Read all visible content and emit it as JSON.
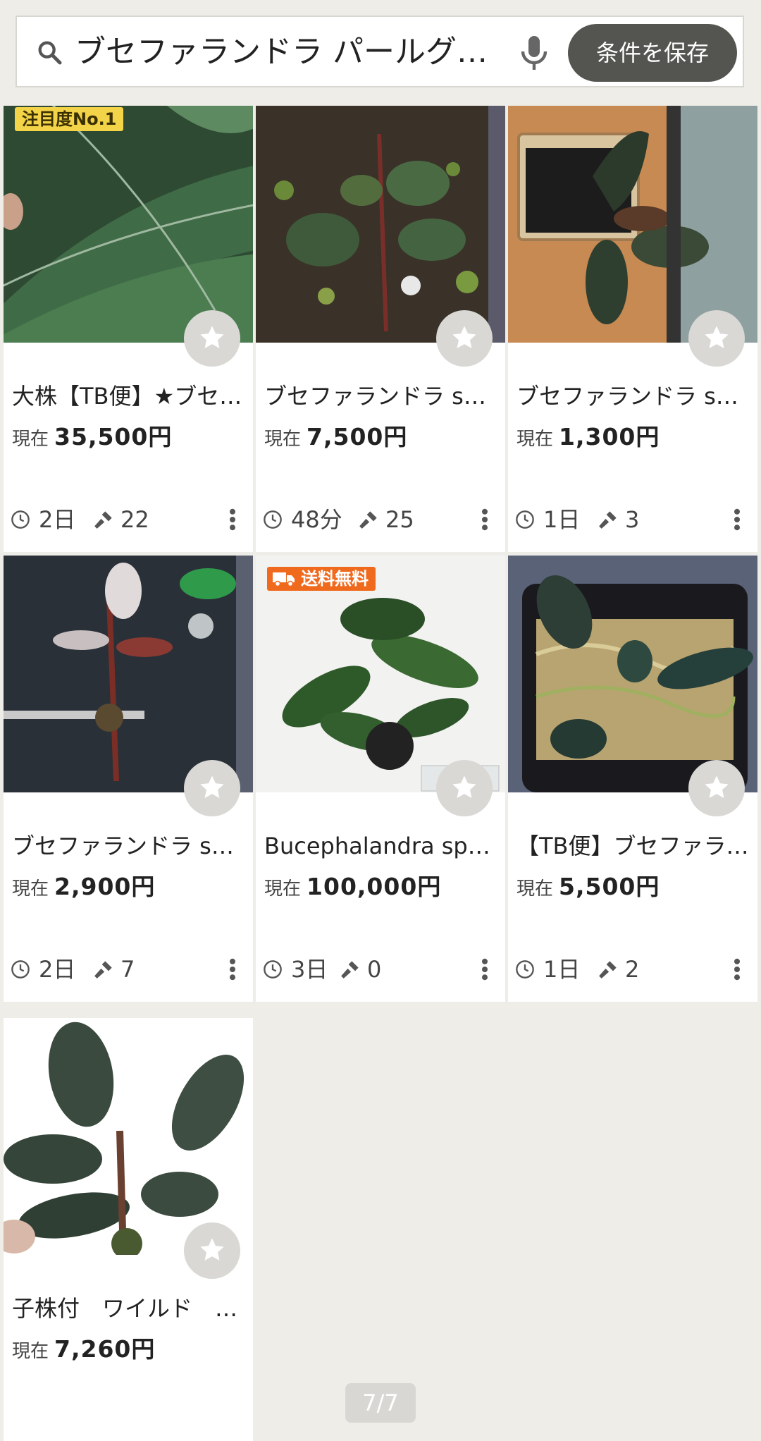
{
  "search": {
    "query": "ブセファランドラ パールグ…",
    "save_label": "条件を保存"
  },
  "items": [
    {
      "title": "大株【TB便】★ブセ…",
      "price_label": "現在",
      "price": "35,500円",
      "time": "2日",
      "bids": "22",
      "badge": "注目度No.1"
    },
    {
      "title": "ブセファランドラ s…",
      "price_label": "現在",
      "price": "7,500円",
      "time": "48分",
      "bids": "25",
      "badge": ""
    },
    {
      "title": "ブセファランドラ s…",
      "price_label": "現在",
      "price": "1,300円",
      "time": "1日",
      "bids": "3",
      "badge": ""
    },
    {
      "title": "ブセファランドラ s…",
      "price_label": "現在",
      "price": "2,900円",
      "time": "2日",
      "bids": "7",
      "badge": ""
    },
    {
      "title": "Bucephalandra sp.…",
      "price_label": "現在",
      "price": "100,000円",
      "time": "3日",
      "bids": "0",
      "badge": "送料無料"
    },
    {
      "title": "【TB便】ブセファラ…",
      "price_label": "現在",
      "price": "5,500円",
      "time": "1日",
      "bids": "2",
      "badge": ""
    },
    {
      "title": "子株付　ワイルド　…",
      "price_label": "現在",
      "price": "7,260円",
      "time": "",
      "bids": "",
      "badge": ""
    }
  ],
  "pager": "7/7",
  "colors": {
    "background": "#efede8",
    "save_button": "#545550",
    "attention_badge": "#f3d348",
    "shipping_badge": "#f06a1e"
  }
}
